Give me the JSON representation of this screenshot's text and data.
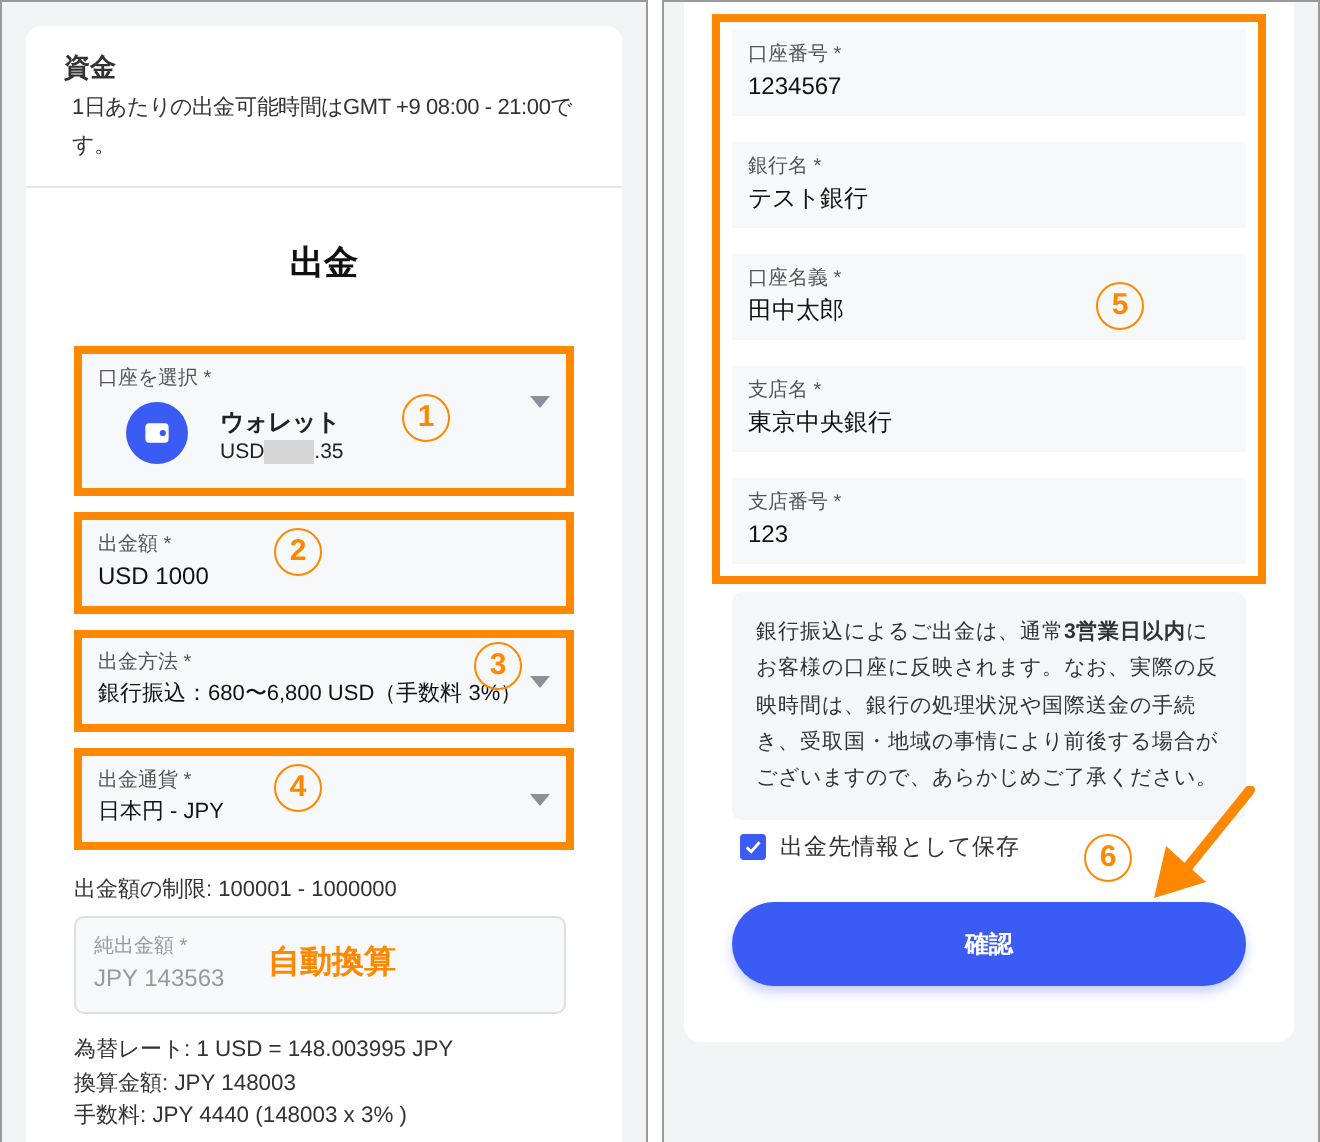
{
  "left_screen": {
    "notice": {
      "title": "資金",
      "text": "1日あたりの出金可能時間はGMT +9 08:00 - 21:00です。"
    },
    "heading": "出金",
    "fields": [
      {
        "kind": "account",
        "label": "口座を選択 *",
        "name": "ウォレット",
        "balance_start": "USD",
        "balance_end": ".35",
        "dropdown": true,
        "highlighted": true,
        "marker": "1"
      },
      {
        "kind": "text",
        "label": "出金額 *",
        "value": "USD 1000",
        "dropdown": false,
        "highlighted": true,
        "marker": "2"
      },
      {
        "kind": "text",
        "label": "出金方法 *",
        "value": "銀行振込：680〜6,800 USD（手数料 3%）",
        "dropdown": true,
        "highlighted": true,
        "marker": "3"
      },
      {
        "kind": "text",
        "label": "出金通貨 *",
        "value": "日本円 - JPY",
        "dropdown": true,
        "highlighted": true,
        "marker": "4"
      }
    ],
    "limit": "出金額の制限: 100001 - 1000000",
    "net_amount": {
      "label": "純出金額 *",
      "value": "JPY 143563",
      "disabled": true,
      "annotation": "自動換算"
    },
    "details": [
      "為替レート: 1 USD = 148.003995 JPY",
      "換算金額: JPY 148003",
      "手数料: JPY 4440 (148003 x 3% )"
    ]
  },
  "right_screen": {
    "bank_fields": [
      {
        "label": "口座番号 *",
        "value": "1234567"
      },
      {
        "label": "銀行名 *",
        "value": "テスト銀行"
      },
      {
        "label": "口座名義 *",
        "value": "田中太郎"
      },
      {
        "label": "支店名 *",
        "value": "東京中央銀行"
      },
      {
        "label": "支店番号 *",
        "value": "123"
      }
    ],
    "bank_group": {
      "highlighted": true,
      "marker": "5"
    },
    "note": "銀行振込によるご出金は、通常**3営業日以内**にお客様の口座に反映されます。なお、実際の反映時間は、銀行の処理状況や国際送金の手続き、受取国・地域の事情により前後する場合がございますので、あらかじめご了承ください。",
    "save_checkbox": {
      "label": "出金先情報として保存",
      "checked": true
    },
    "confirm_button": {
      "label": "確認",
      "marker": "6"
    }
  }
}
